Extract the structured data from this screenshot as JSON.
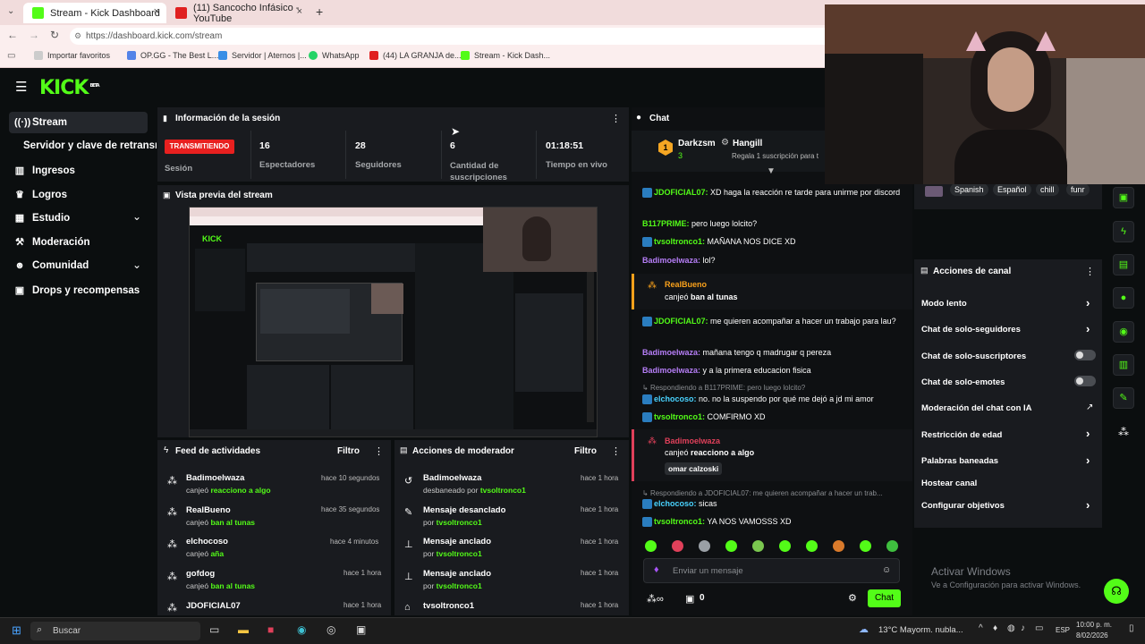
{
  "browser": {
    "tabs": [
      {
        "title": "Stream - Kick Dashboard",
        "close": "×"
      },
      {
        "title": "(11) Sancocho Infásico - YouTube",
        "close": "×"
      }
    ],
    "new_tab": "+",
    "url": "https://dashboard.kick.com/stream",
    "bookmarks": [
      "Importar favoritos",
      "OP.GG - The Best L...",
      "Servidor | Aternos |...",
      "WhatsApp",
      "(44) LA GRANJA de...",
      "Stream - Kick Dash..."
    ]
  },
  "brand": {
    "logo": "KICK",
    "beta": "BETA",
    "accent": "#53fc18"
  },
  "sidebar": {
    "items": [
      {
        "label": "Stream",
        "icon": "broadcast-icon"
      },
      {
        "label": "Servidor y clave de retransmisión",
        "icon": ""
      },
      {
        "label": "Ingresos",
        "icon": "bar-chart-icon"
      },
      {
        "label": "Logros",
        "icon": "trophy-icon"
      },
      {
        "label": "Estudio",
        "icon": "grid-icon"
      },
      {
        "label": "Moderación",
        "icon": "hammer-icon"
      },
      {
        "label": "Comunidad",
        "icon": "users-icon"
      },
      {
        "label": "Drops y recompensas",
        "icon": "gift-icon"
      }
    ]
  },
  "session": {
    "title": "Información de la sesión",
    "status_badge": "TRANSMITIENDO",
    "status_label": "Sesión",
    "stats": [
      {
        "value": "16",
        "label": "Espectadores"
      },
      {
        "value": "28",
        "label": "Seguidores"
      },
      {
        "value": "6",
        "label": "Cantidad de suscripciones"
      },
      {
        "value": "01:18:51",
        "label": "Tiempo en vivo"
      }
    ]
  },
  "preview": {
    "title": "Vista previa del stream"
  },
  "feed": {
    "title": "Feed de actividades",
    "filter": "Filtro",
    "items": [
      {
        "user": "Badimoelwaza",
        "action": "canjeó",
        "reward": "reacciono a algo",
        "time": "hace 10 segundos"
      },
      {
        "user": "RealBueno",
        "action": "canjeó",
        "reward": "ban al tunas",
        "time": "hace 35 segundos"
      },
      {
        "user": "elchocoso",
        "action": "canjeó",
        "reward": "aña",
        "time": "hace 4 minutos"
      },
      {
        "user": "gofdog",
        "action": "canjeó",
        "reward": "ban al tunas",
        "time": "hace 1 hora"
      },
      {
        "user": "JDOFICIAL07",
        "action": "",
        "reward": "",
        "time": "hace 1 hora"
      }
    ]
  },
  "modactions": {
    "title": "Acciones de moderador",
    "filter": "Filtro",
    "items": [
      {
        "title": "Badimoelwaza",
        "sub": "desbaneado por",
        "by": "tvsoltronco1",
        "time": "hace 1 hora"
      },
      {
        "title": "Mensaje desanclado",
        "sub": "por",
        "by": "tvsoltronco1",
        "time": "hace 1 hora"
      },
      {
        "title": "Mensaje anclado",
        "sub": "por",
        "by": "tvsoltronco1",
        "time": "hace 1 hora"
      },
      {
        "title": "Mensaje anclado",
        "sub": "por",
        "by": "tvsoltronco1",
        "time": "hace 1 hora"
      },
      {
        "title": "tvsoltronco1",
        "sub": "",
        "by": "",
        "time": "hace 1 hora"
      }
    ]
  },
  "chat": {
    "title": "Chat",
    "pinned": {
      "rank": "1",
      "user": "Darkzsm",
      "count": "3",
      "gifter": "Hangill",
      "gift_text": "Regala 1 suscripción para t"
    },
    "messages": [
      {
        "user": "JDOFICIAL07:",
        "text": "XD haga la reacción re tarde para unirme por discord"
      },
      {
        "user": "B117PRIME:",
        "text": "pero luego lolcito?"
      },
      {
        "user": "tvsoltronco1:",
        "text": "MAÑANA NOS DICE XD"
      },
      {
        "user": "Badimoelwaza:",
        "text": "lol?"
      },
      {
        "user": "RealBueno",
        "text": "canjeó",
        "reward": "ban al tunas"
      },
      {
        "user": "JDOFICIAL07:",
        "text": "me quieren acompañar a hacer un trabajo para lau?"
      },
      {
        "user": "Badimoelwaza:",
        "text": "mañana tengo q madrugar q pereza"
      },
      {
        "user": "Badimoelwaza:",
        "text": "y a la primera educacion fisica"
      },
      {
        "reply": "Respondiendo a B117PRIME: pero luego lolcito?"
      },
      {
        "user": "elchocoso:",
        "text": "no. no la suspendo por qué me dejó a jd mi amor"
      },
      {
        "user": "tvsoltronco1:",
        "text": "COMFIRMO XD"
      },
      {
        "user": "Badimoelwaza",
        "text": "canjeó",
        "reward": "reacciono a algo",
        "extra": "omar calzoski"
      },
      {
        "reply": "Respondiendo a JDOFICIAL07: me quieren acompañar a hacer un trab..."
      },
      {
        "user": "elchocoso:",
        "text": "sicas"
      },
      {
        "user": "tvsoltronco1:",
        "text": "YA NOS VAMOSSS XD"
      }
    ],
    "input_placeholder": "Enviar un mensaje",
    "points": "0",
    "send": "Chat"
  },
  "stream_tags": [
    "Spanish",
    "Español",
    "chill",
    "funr"
  ],
  "channel_actions": {
    "title": "Acciones de canal",
    "items": [
      {
        "label": "Modo lento",
        "control": "chevron"
      },
      {
        "label": "Chat de solo-seguidores",
        "control": "chevron"
      },
      {
        "label": "Chat de solo-suscriptores",
        "control": "toggle"
      },
      {
        "label": "Chat de solo-emotes",
        "control": "toggle"
      },
      {
        "label": "Moderación del chat con IA",
        "control": "external"
      },
      {
        "label": "Restricción de edad",
        "control": "chevron"
      },
      {
        "label": "Palabras baneadas",
        "control": "chevron"
      },
      {
        "label": "Hostear canal",
        "control": "none"
      },
      {
        "label": "Configurar objetivos",
        "control": "chevron"
      }
    ]
  },
  "watermark": {
    "line1": "Activar Windows",
    "line2": "Ve a Configuración para activar Windows."
  },
  "taskbar": {
    "search": "Buscar",
    "weather": "13°C  Mayorm. nubla...",
    "lang": "ESP",
    "time": "10:00 p. m.",
    "date": "8/02/2026"
  }
}
